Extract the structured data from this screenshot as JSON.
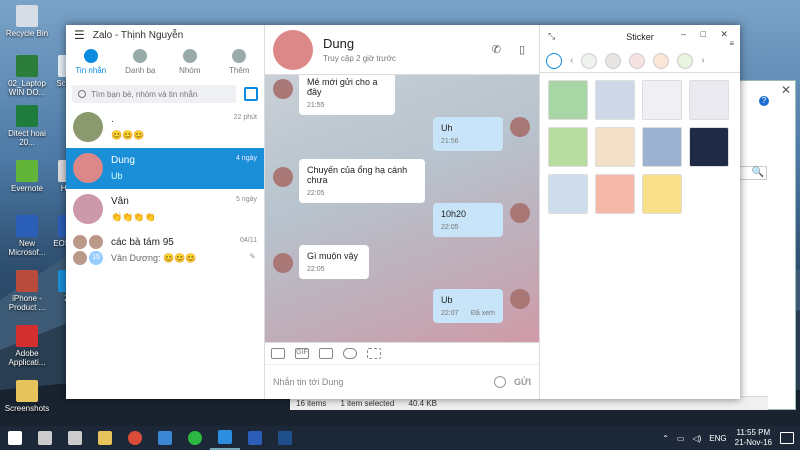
{
  "desktop": {
    "icons": [
      {
        "label": "Recycle Bin",
        "color": "#d6dde6"
      },
      {
        "label": "02_Laptop WIN DO...",
        "color": "#2d7d3a"
      },
      {
        "label": "Screen",
        "color": "#e5eef5"
      },
      {
        "label": "Ditect hoai 20...",
        "color": "#1e7d3c"
      },
      {
        "label": "Evernote",
        "color": "#63b53a"
      },
      {
        "label": "Hinh",
        "color": "#ddd"
      },
      {
        "label": "New Microsof...",
        "color": "#2b5eb8"
      },
      {
        "label": "EOS D...",
        "color": "#2b5eb8"
      },
      {
        "label": "iPhone - Product ...",
        "color": "#b84b3b"
      },
      {
        "label": "Za",
        "color": "#1a8fd8"
      },
      {
        "label": "Adobe Applicati...",
        "color": "#d32f2f"
      },
      {
        "label": "Screenshots",
        "color": "#e7c45b"
      }
    ]
  },
  "explorer": {
    "close": "✕",
    "help": "?",
    "search_icon": "🔍",
    "status_items": "16 items",
    "status_selected": "1 item selected",
    "status_size": "40.4 KB"
  },
  "zalo": {
    "window_title": "Zalo - Thịnh Nguyễn",
    "nav": [
      {
        "label": "Tin nhắn",
        "active": true
      },
      {
        "label": "Danh bạ",
        "active": false
      },
      {
        "label": "Nhóm",
        "active": false
      },
      {
        "label": "Thêm",
        "active": false
      }
    ],
    "search_placeholder": "Tìm bạn bè, nhóm và tin nhắn",
    "conversations": [
      {
        "name": ".",
        "preview": "😊😊😊",
        "time": "22 phút",
        "active": false
      },
      {
        "name": "Dung",
        "preview": "Ub",
        "time": "4 ngày",
        "active": true
      },
      {
        "name": "Vân",
        "preview": "👏👏👏👏",
        "time": "5 ngày",
        "active": false
      },
      {
        "name": "các bà tám 95",
        "preview": "Vân Dương: 😊😊😊",
        "time": "04/11",
        "active": false,
        "badge": "15"
      }
    ]
  },
  "chat": {
    "contact_name": "Dung",
    "status": "Truy cập 2 giờ trước",
    "messages": [
      {
        "dir": "in",
        "text": "Mẻ mới gửi cho a đây",
        "time": "21:55"
      },
      {
        "dir": "out",
        "text": "Uh",
        "time": "21:56"
      },
      {
        "dir": "in",
        "text": "Chuyến của ổng hạ cánh chưa",
        "time": "22:05"
      },
      {
        "dir": "out",
        "text": "10h20",
        "time": "22:05"
      },
      {
        "dir": "in",
        "text": "Gì muộn vậy",
        "time": "22:05"
      },
      {
        "dir": "out",
        "text": "Ub",
        "time": "22:07",
        "seen": "Đã xem"
      }
    ],
    "toolbar_gif": "GIF",
    "input_placeholder": "Nhắn tin tới Dung",
    "send_label": "GỬI"
  },
  "sticker": {
    "title": "Sticker",
    "collapse_icon": "⤡",
    "window_controls": "– □ ✕",
    "more_icon": "≡",
    "tab_colors": [
      "#ffffff",
      "#eef2ee",
      "#e8e4e4",
      "#f6e2e2",
      "#fbe5d6",
      "#e8f4e0"
    ],
    "stickers": [
      "#a9d6a5",
      "#cfd8e8",
      "#f0f0f4",
      "#e9e9ef",
      "#b9dca0",
      "#f2e1c8",
      "#9bb3d1",
      "#1f2a47",
      "#cfdcec",
      "#f4b9a8",
      "#f8e08a"
    ]
  },
  "taskbar": {
    "apps": [
      {
        "name": "windows",
        "color": "#ffffff"
      },
      {
        "name": "search",
        "color": "#cccccc"
      },
      {
        "name": "task-view",
        "color": "#cccccc"
      },
      {
        "name": "file-explorer",
        "color": "#e7c45b"
      },
      {
        "name": "chrome",
        "color": "#dd4b39"
      },
      {
        "name": "store",
        "color": "#3c87d4"
      },
      {
        "name": "line",
        "color": "#2bb741"
      },
      {
        "name": "zalo",
        "color": "#2d8fdf",
        "active": true
      },
      {
        "name": "word",
        "color": "#2b5eb8"
      },
      {
        "name": "photoshop",
        "color": "#1f4f8b"
      }
    ],
    "language": "ENG",
    "time": "11:55 PM",
    "date": "21-Nov-16"
  }
}
